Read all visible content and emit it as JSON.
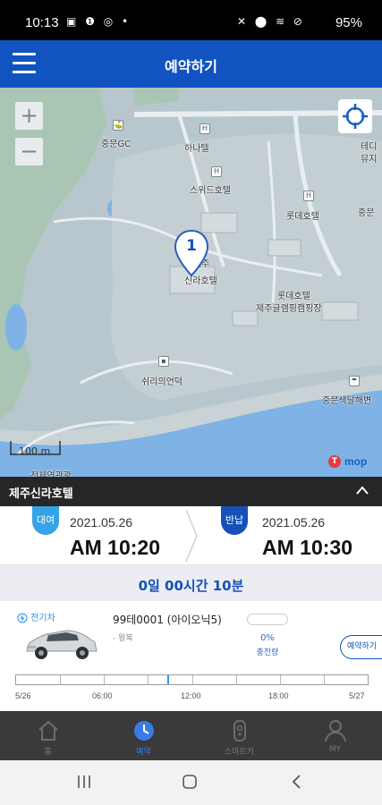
{
  "status_bar": {
    "time": "10:13",
    "left_icons": "▣ ❶ ◎ •",
    "right_icons": "✕ ⬤ ≋ ⊘",
    "battery": "95%"
  },
  "header": {
    "title": "예약하기"
  },
  "map": {
    "zoom_in": "+",
    "zoom_out": "−",
    "labels": {
      "golf": "중문GC",
      "hanatel": "하나텔",
      "swiss": "스위드호텔",
      "lotte": "롯데호텔",
      "lotte_resort_1": "롯데호텔",
      "lotte_resort_2": "제주글램핑캠핑장",
      "shilla": "신라호텔",
      "shilla_prefix": "제주",
      "theater": "쉬리의언덕",
      "beach": "중문색달해변",
      "jungmun": "중문",
      "tedi_1": "테디",
      "tedi_2": "뮤지",
      "bottom_cut": "천제연관광"
    },
    "pin_number": "1",
    "scale": "100 m",
    "brand": "mop",
    "brand_mark": "T"
  },
  "place": {
    "name": "제주신라호텔"
  },
  "reservation": {
    "rent_label": "대여",
    "rent_date": "2021.05.26",
    "rent_time": "AM 10:20",
    "return_label": "반납",
    "return_date": "2021.05.26",
    "return_time": "AM 10:30"
  },
  "duration": "0일 00시간 10분",
  "vehicle": {
    "ev_badge": "전기차",
    "plate": "99테0001 (아이오닉5)",
    "location": "- 왕복",
    "charge_level": 0,
    "charge_pct": "0%",
    "charge_label": "충전량",
    "reserve_button": "예약하기"
  },
  "timeline": {
    "now_fraction": 0.43,
    "ticks": [
      "5/26",
      "06:00",
      "12:00",
      "18:00",
      "5/27"
    ]
  },
  "bottom_nav": [
    {
      "label": "홈",
      "icon": "home-icon",
      "active": false
    },
    {
      "label": "예약",
      "icon": "clock-icon",
      "active": true
    },
    {
      "label": "스마트키",
      "icon": "smartkey-icon",
      "active": false
    },
    {
      "label": "MY",
      "icon": "user-icon",
      "active": false
    }
  ],
  "colors": {
    "header": "#1153c0",
    "rent": "#33a4e6",
    "return": "#1650b8",
    "active_nav": "#3b7be6"
  }
}
